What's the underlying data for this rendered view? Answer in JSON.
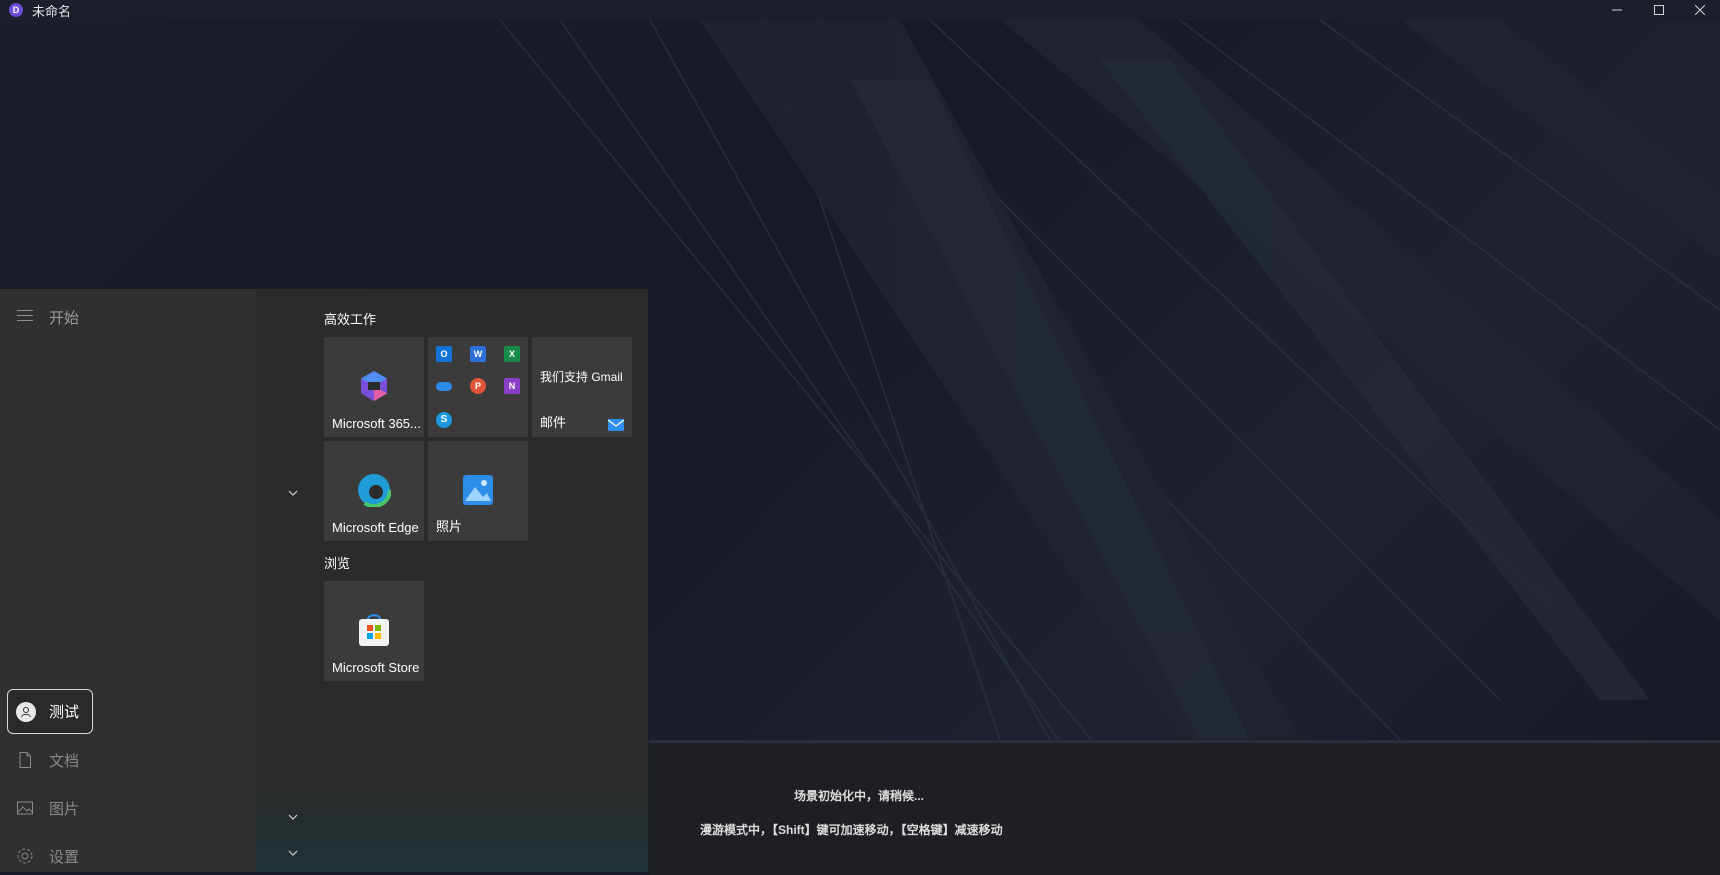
{
  "window": {
    "title": "未命名",
    "app_icon_letter": "D",
    "accent_color": "#6b4bd8"
  },
  "start_menu": {
    "header_label": "开始",
    "user": {
      "name": "测试"
    },
    "nav": [
      {
        "label": "文档",
        "icon": "document-icon"
      },
      {
        "label": "图片",
        "icon": "image-icon"
      },
      {
        "label": "设置",
        "icon": "gear-icon"
      }
    ],
    "groups": [
      {
        "title": "高效工作"
      },
      {
        "title": "浏览"
      }
    ],
    "tiles": {
      "m365": {
        "label": "Microsoft 365..."
      },
      "office_apps": {
        "icons": [
          "outlook-icon",
          "word-icon",
          "excel-icon",
          "onedrive-icon",
          "powerpoint-icon",
          "onenote-icon",
          "skype-icon"
        ]
      },
      "mail": {
        "headline": "我们支持 Gmail",
        "label": "邮件"
      },
      "edge": {
        "label": "Microsoft Edge"
      },
      "photos": {
        "label": "照片"
      },
      "store": {
        "label": "Microsoft Store"
      }
    }
  },
  "status": {
    "line1": "场景初始化中，请稍候...",
    "line2": "漫游模式中，【Shift】键可加速移动，【空格键】减速移动"
  }
}
